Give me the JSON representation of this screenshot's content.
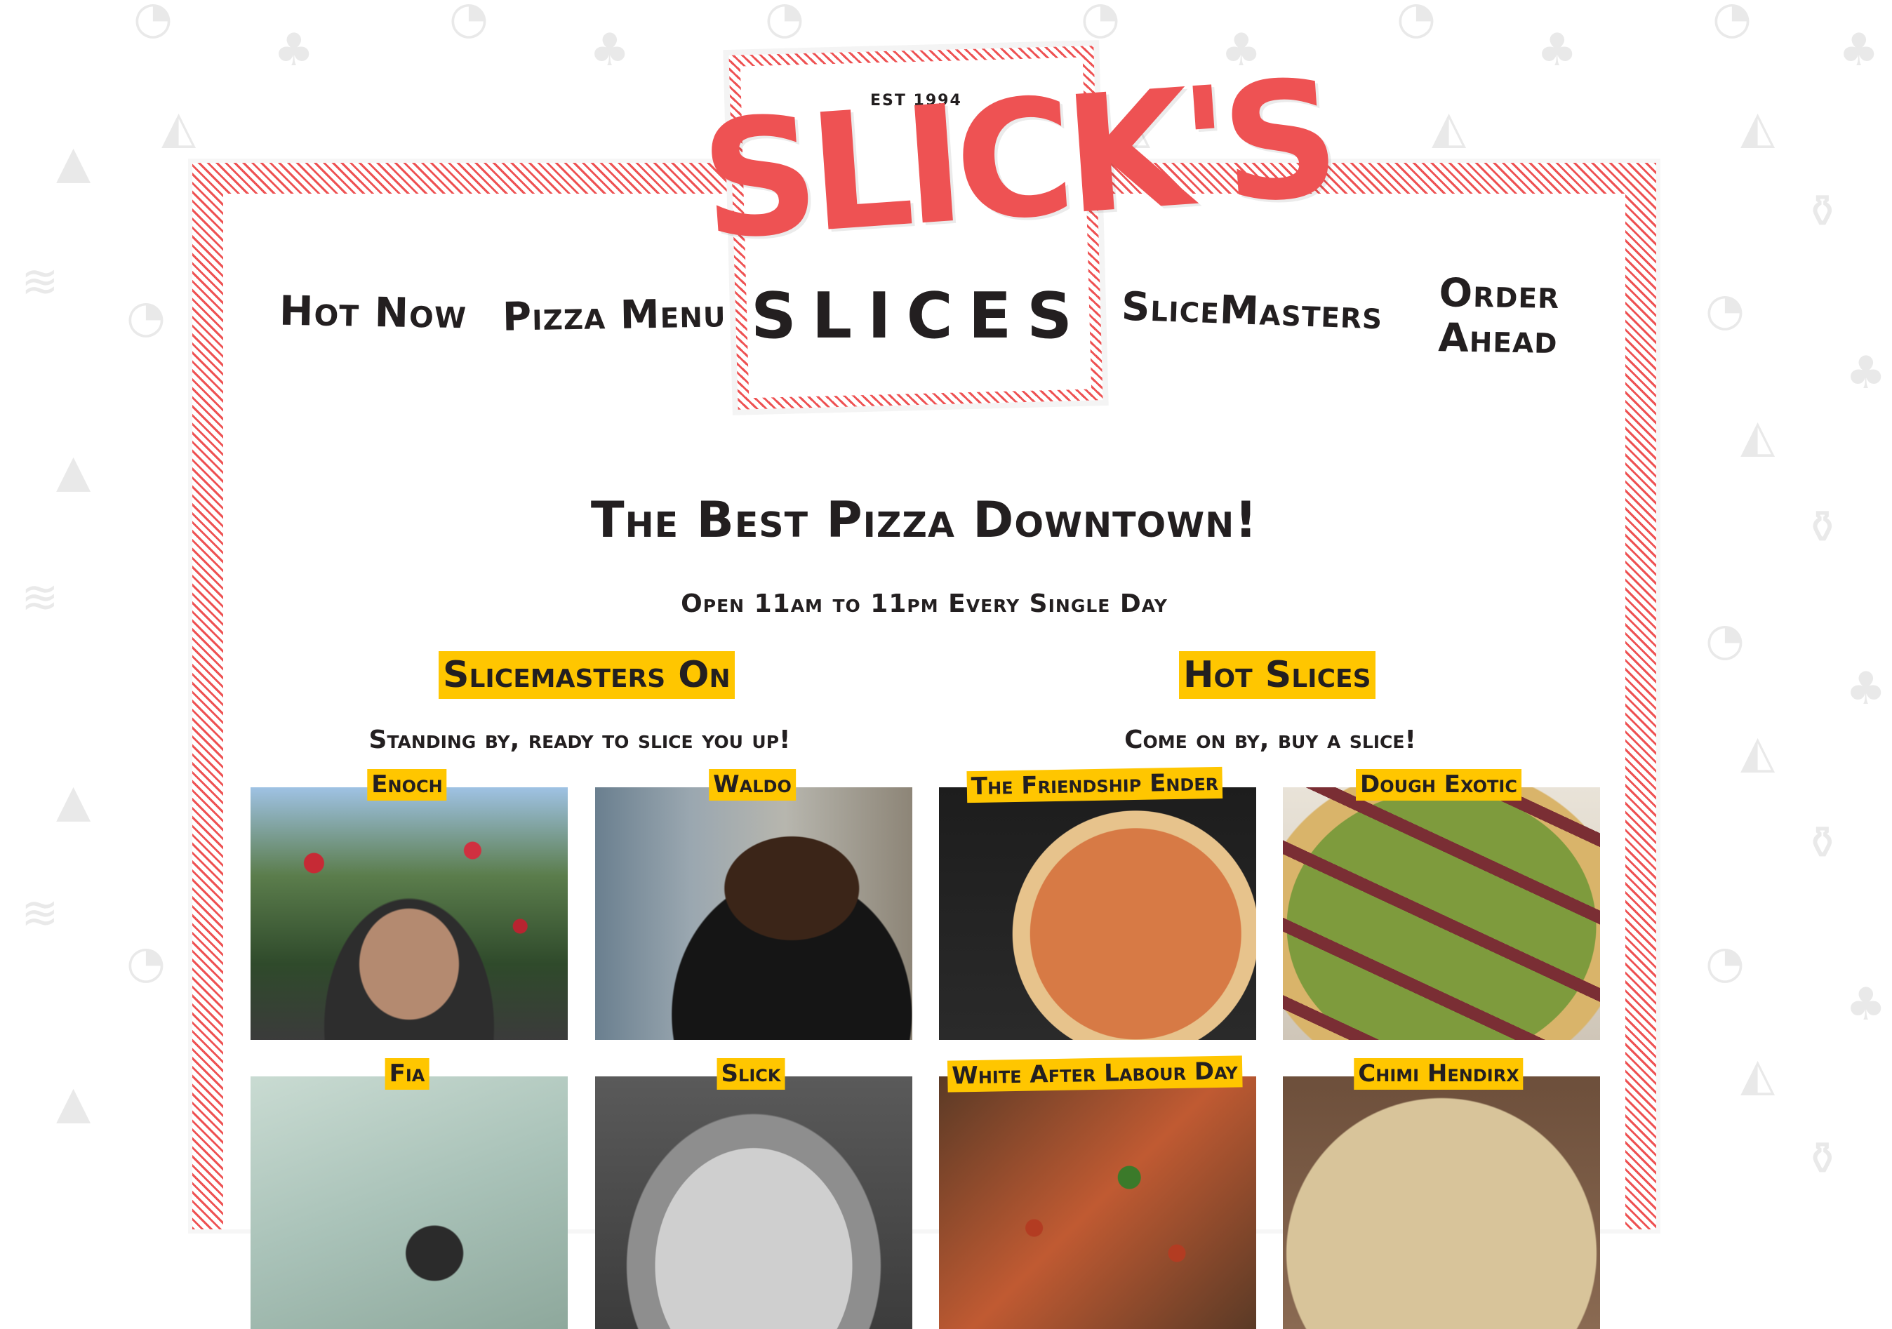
{
  "logo": {
    "est": "EST 1994",
    "name_top": "SLICK'S",
    "name_bottom": "SLICES"
  },
  "nav": {
    "hot_now": "Hot Now",
    "pizza_menu": "Pizza Menu",
    "slicemasters": "SliceMasters",
    "order_ahead": "Order Ahead"
  },
  "hero": {
    "title": "The Best Pizza Downtown!",
    "subtitle": "Open 11am to 11pm Every Single Day"
  },
  "slicemasters": {
    "title": "Slicemasters On",
    "subtitle": "Standing by, ready to slice you up!",
    "people": [
      {
        "name": "Enoch"
      },
      {
        "name": "Waldo"
      },
      {
        "name": "Fia"
      },
      {
        "name": "Slick"
      }
    ]
  },
  "hot_slices": {
    "title": "Hot Slices",
    "subtitle": "Come on by, buy a slice!",
    "pizzas": [
      {
        "name": "The Friendship Ender"
      },
      {
        "name": "Dough Exotic"
      },
      {
        "name": "White After Labour Day"
      },
      {
        "name": "Chimi Hendirx"
      }
    ]
  },
  "colors": {
    "accent_red": "#ee5253",
    "highlight_yellow": "#ffc600",
    "text": "#231f20"
  },
  "icons": {
    "background": [
      "pizza-icon",
      "mushroom-icon",
      "cheese-icon",
      "slice-icon",
      "bacon-icon",
      "bottles-icon"
    ]
  }
}
